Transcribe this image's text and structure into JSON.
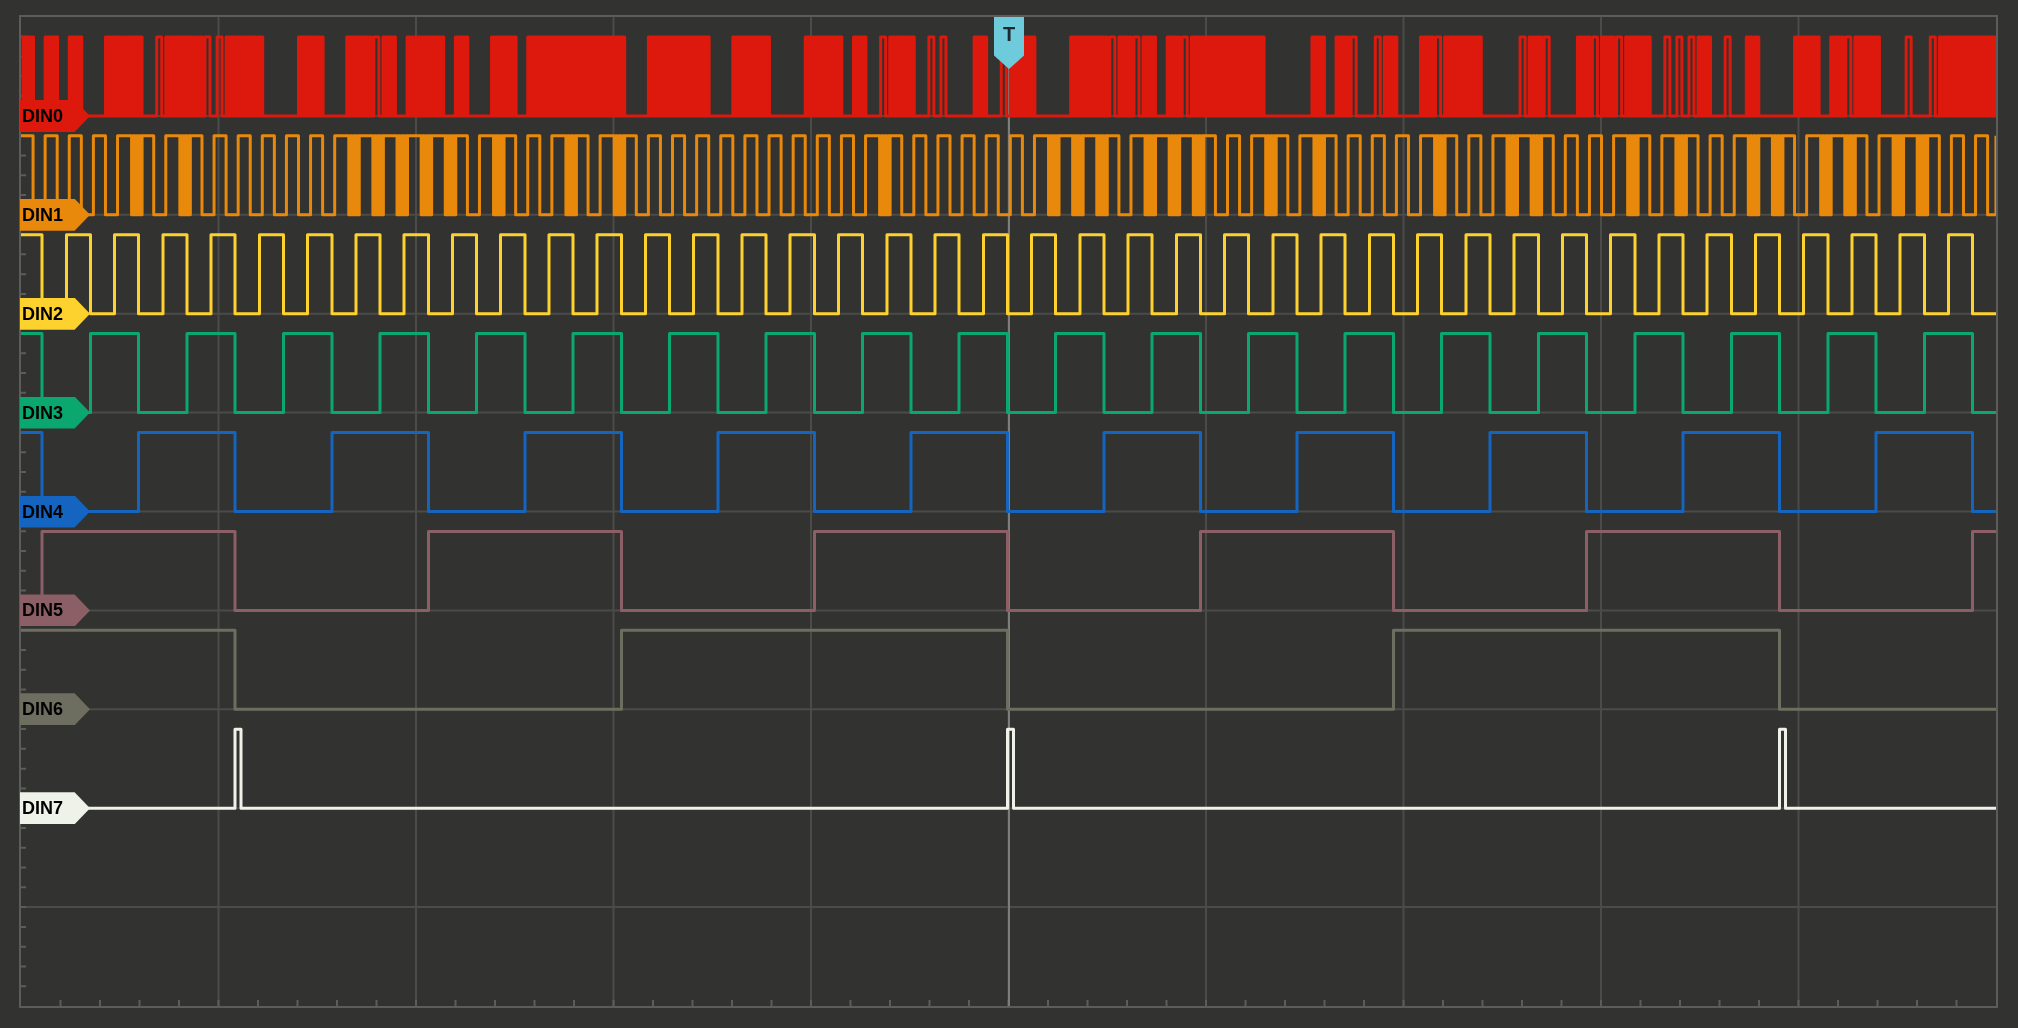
{
  "channels": [
    {
      "name": "DIN0",
      "color": "#dc190c"
    },
    {
      "name": "DIN1",
      "color": "#e8890c"
    },
    {
      "name": "DIN2",
      "color": "#fdd22e"
    },
    {
      "name": "DIN3",
      "color": "#0aa86e"
    },
    {
      "name": "DIN4",
      "color": "#1565c0"
    },
    {
      "name": "DIN5",
      "color": "#8c5f66"
    },
    {
      "name": "DIN6",
      "color": "#6d6e60"
    },
    {
      "name": "DIN7",
      "color": "#eef2e8"
    }
  ],
  "trigger": {
    "label": "T"
  }
}
